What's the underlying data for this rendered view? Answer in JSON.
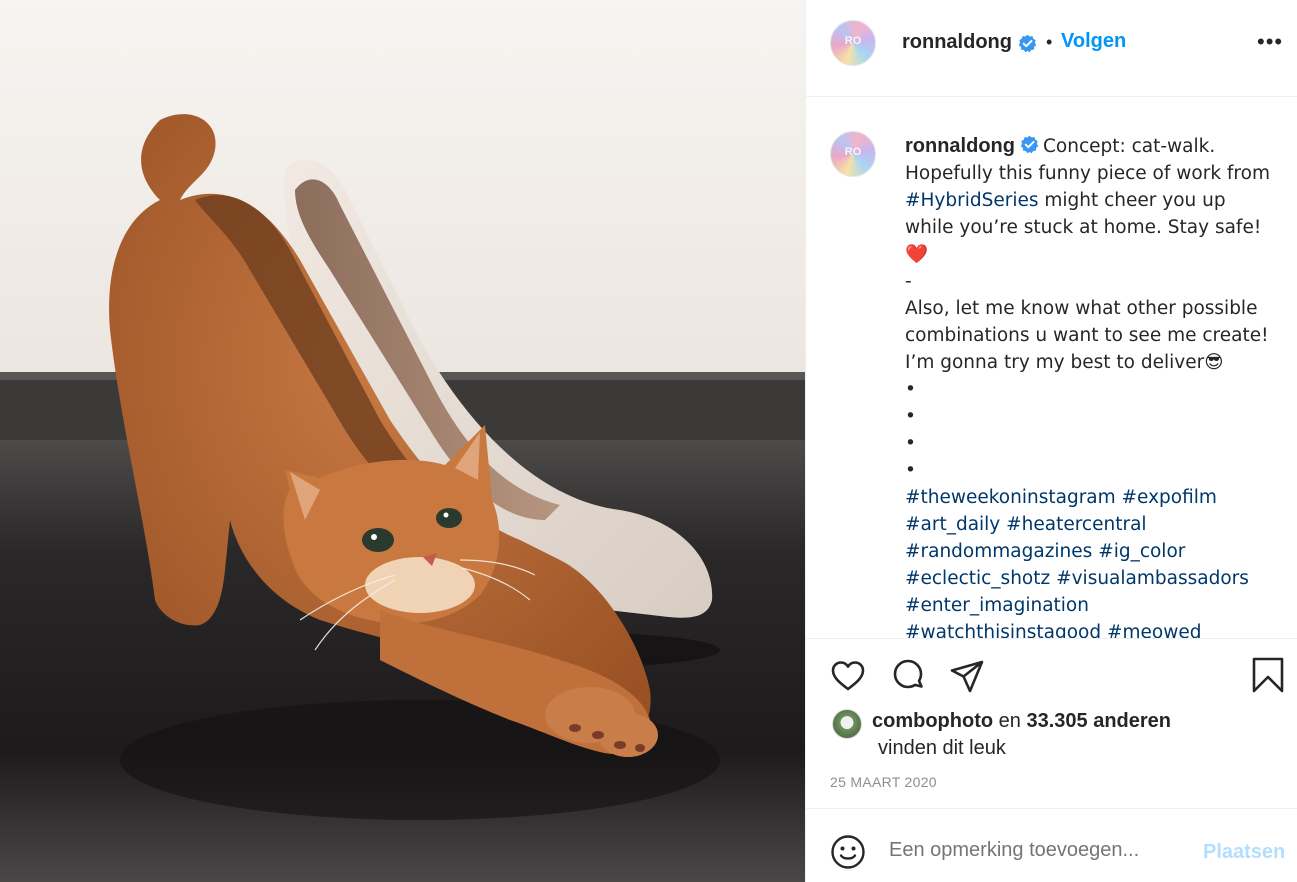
{
  "post": {
    "username": "ronnaldong",
    "avatar_text": "RO",
    "separator": "•",
    "follow_label": "Volgen",
    "more_label": "•••"
  },
  "caption": {
    "username": "ronnaldong",
    "line1": "Concept: cat-walk. Hopefully this funny piece of work from ",
    "hashtag_inline": "#HybridSeries",
    "line1b": " might cheer you up while you’re stuck at home. Stay safe! ",
    "heart_emoji": "❤️",
    "dash": "-",
    "line2": "Also, let me know what other possible combinations u want to see me create! I’m gonna try my best to deliver",
    "sunglasses_emoji": "😎",
    "bullets": [
      "•",
      "•",
      "•",
      "•"
    ],
    "hashtags": [
      "#theweekoninstagram",
      "#expofilm",
      "#art_daily",
      "#heatercentral",
      "#randommagazines",
      "#ig_color",
      "#eclectic_shotz",
      "#visualambassadors",
      "#enter_imagination",
      "#watchthisinstagood",
      "#meowed"
    ]
  },
  "likes": {
    "liker": "combophoto",
    "connector": "en",
    "count": "33.305 anderen",
    "suffix": "vinden dit leuk"
  },
  "date": "25 MAART 2020",
  "comment_box": {
    "placeholder": "Een opmerking toevoegen...",
    "post_label": "Plaatsen"
  },
  "icons": {
    "like": "heart-icon",
    "comment": "comment-icon",
    "share": "send-icon",
    "save": "bookmark-icon",
    "emoji": "smiley-icon",
    "verified": "verified-badge-icon"
  },
  "colors": {
    "accent": "#0095f6",
    "hashtag": "#00376b",
    "muted": "#8e8e8e",
    "post_disabled": "#b2dffc",
    "verified": "#3897f0"
  }
}
